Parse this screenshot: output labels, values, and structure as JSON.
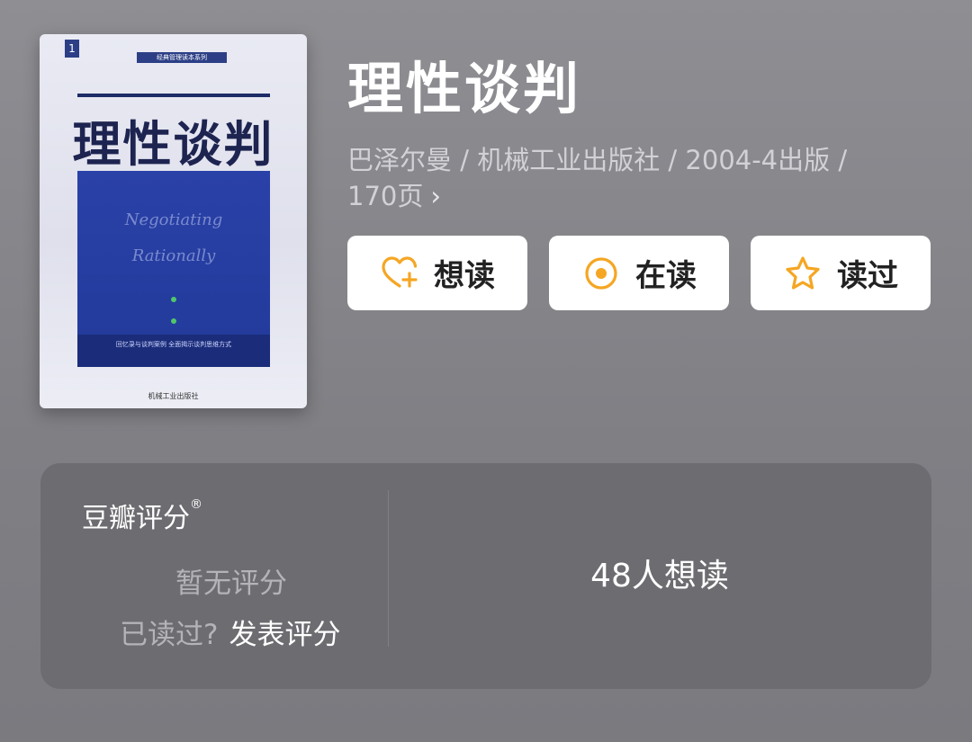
{
  "book": {
    "title": "理性谈判",
    "meta_line1": "巴泽尔曼 / 机械工业出版社 / 2004-4出版 /",
    "meta_line2": "170页"
  },
  "cover": {
    "corner_logo": "1",
    "series": "经典管理读本系列",
    "title": "理性谈判",
    "script_line1": "Negotiating",
    "script_line2": "Rationally",
    "panel_foot": "回忆录与谈判案例   全面揭示谈判思维方式",
    "publisher": "机械工业出版社"
  },
  "actions": [
    {
      "label": "想读",
      "icon": "heart-plus-icon"
    },
    {
      "label": "在读",
      "icon": "target-circle-icon"
    },
    {
      "label": "读过",
      "icon": "star-icon"
    }
  ],
  "rating": {
    "label": "豆瓣评分",
    "registered_mark": "®",
    "status": "暂无评分",
    "read_question": "已读过?",
    "rate_link": "发表评分",
    "want_count": "48人想读"
  },
  "colors": {
    "accent": "#f5a623",
    "background": "#8a8a8f",
    "card": "#6c6c71"
  }
}
